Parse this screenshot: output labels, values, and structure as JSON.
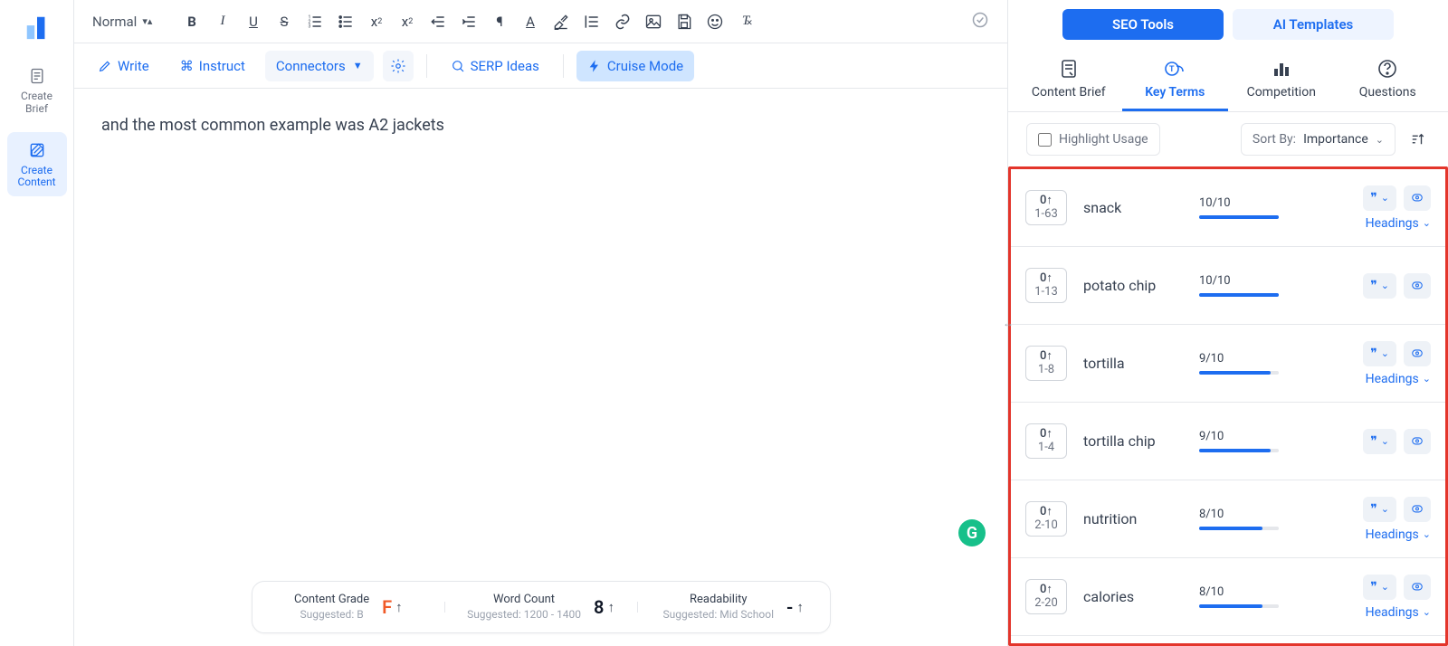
{
  "rail": {
    "create_brief": "Create Brief",
    "create_content": "Create Content"
  },
  "format_bar": {
    "style": "Normal"
  },
  "action_bar": {
    "write": "Write",
    "instruct": "Instruct",
    "connectors": "Connectors",
    "serp_ideas": "SERP Ideas",
    "cruise": "Cruise Mode"
  },
  "editor": {
    "body": "and the most common example was A2 jackets"
  },
  "stats": {
    "grade_title": "Content Grade",
    "grade_sub": "Suggested: B",
    "grade_value": "F",
    "words_title": "Word Count",
    "words_sub": "Suggested: 1200 - 1400",
    "words_value": "8",
    "read_title": "Readability",
    "read_sub": "Suggested: Mid School",
    "read_value": "-"
  },
  "panel": {
    "mode": {
      "seo": "SEO Tools",
      "ai": "AI Templates"
    },
    "sections": {
      "brief": "Content Brief",
      "terms": "Key Terms",
      "competition": "Competition",
      "questions": "Questions"
    },
    "highlight": "Highlight Usage",
    "sort_label": "Sort By:",
    "sort_value": "Importance",
    "headings_label": "Headings",
    "terms": [
      {
        "count": "0↑",
        "range": "1-63",
        "name": "snack",
        "score": "10/10",
        "bar": 100,
        "headings": true
      },
      {
        "count": "0↑",
        "range": "1-13",
        "name": "potato chip",
        "score": "10/10",
        "bar": 100,
        "headings": false
      },
      {
        "count": "0↑",
        "range": "1-8",
        "name": "tortilla",
        "score": "9/10",
        "bar": 90,
        "headings": true
      },
      {
        "count": "0↑",
        "range": "1-4",
        "name": "tortilla chip",
        "score": "9/10",
        "bar": 90,
        "headings": false
      },
      {
        "count": "0↑",
        "range": "2-10",
        "name": "nutrition",
        "score": "8/10",
        "bar": 80,
        "headings": true
      },
      {
        "count": "0↑",
        "range": "2-20",
        "name": "calories",
        "score": "8/10",
        "bar": 80,
        "headings": true
      }
    ]
  }
}
